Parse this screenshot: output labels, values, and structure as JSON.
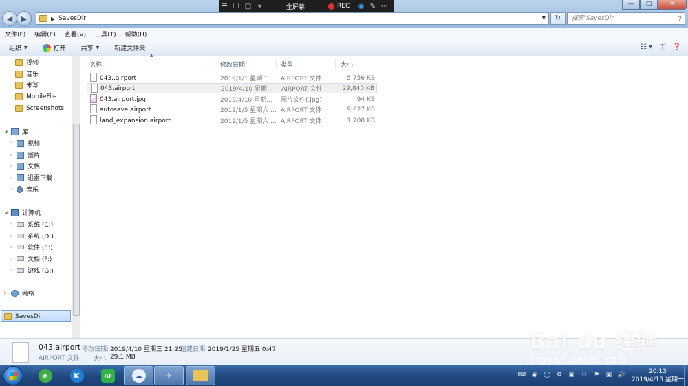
{
  "address": {
    "path": "SavesDir",
    "search_placeholder": "搜索 SavesDir"
  },
  "recorder": {
    "fullscreen": "全屏幕",
    "rec": "REC"
  },
  "menu": [
    "文件(F)",
    "编辑(E)",
    "查看(V)",
    "工具(T)",
    "帮助(H)"
  ],
  "commands": {
    "organize": "组织",
    "open": "打开",
    "share": "共享",
    "new_folder": "新建文件夹"
  },
  "nav": {
    "favorites_tail": [
      "视频",
      "音乐",
      "未写",
      "MobileFile",
      "Screenshots"
    ],
    "library_title": "库",
    "library": [
      "视频",
      "图片",
      "文档",
      "迅雷下载",
      "音乐"
    ],
    "computer_title": "计算机",
    "drives": [
      "系统 (C:)",
      "系统 (D:)",
      "软件 (E:)",
      "文档 (F:)",
      "游戏 (G:)"
    ],
    "network": "网络",
    "selected": "SavesDir"
  },
  "columns": {
    "name": "名称",
    "date": "修改日期",
    "type": "类型",
    "size": "大小"
  },
  "files": [
    {
      "name": "043..airport",
      "date": "2019/1/1 星期二 ...",
      "type": "AIRPORT 文件",
      "size": "5,756 KB"
    },
    {
      "name": "043.airport",
      "date": "2019/4/10 星期...",
      "type": "AIRPORT 文件",
      "size": "29,840 KB"
    },
    {
      "name": "043.airport.jpg",
      "date": "2019/4/10 星期...",
      "type": "图片文件(.jpg)",
      "size": "94 KB"
    },
    {
      "name": "autosave.airport",
      "date": "2019/1/5 星期六 ...",
      "type": "AIRPORT 文件",
      "size": "9,627 KB"
    },
    {
      "name": "land_expansion.airport",
      "date": "2019/1/5 星期六 ...",
      "type": "AIRPORT 文件",
      "size": "1,700 KB"
    }
  ],
  "details": {
    "filename": "043.airport",
    "filetype": "AIRPORT 文件",
    "modified_label": "修改日期:",
    "modified": "2019/4/10 星期三 21:25",
    "created_label": "创建日期:",
    "created": "2019/1/25 星期五 0:47",
    "size_label": "大小:",
    "size": "29.1 MB"
  },
  "clock": {
    "time": "20:13",
    "date": "2019/4/15 星期一"
  },
  "watermark": {
    "brand": "Bai du 经验",
    "url": "jingyan.baidu.com"
  }
}
